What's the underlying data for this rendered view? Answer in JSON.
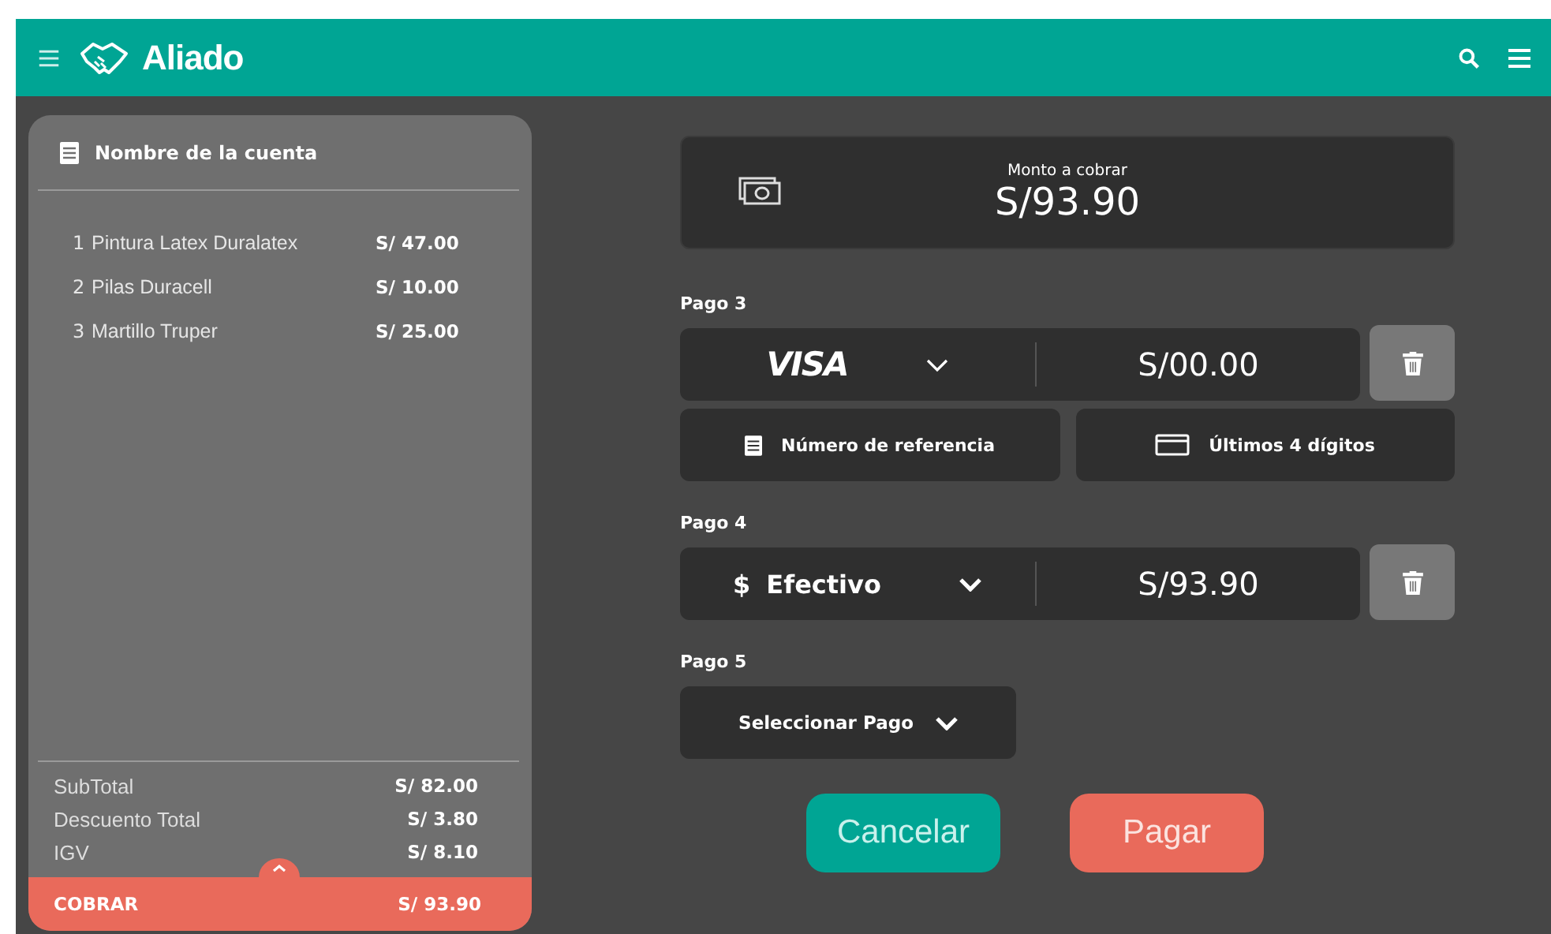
{
  "header": {
    "title": "Aliado"
  },
  "account": {
    "title": "Nombre de la cuenta",
    "items": [
      {
        "index": "1",
        "name": "Pintura Latex Duralatex",
        "price": "S/ 47.00"
      },
      {
        "index": "2",
        "name": "Pilas Duracell",
        "price": "S/ 10.00"
      },
      {
        "index": "3",
        "name": "Martillo Truper",
        "price": "S/ 25.00"
      }
    ],
    "totals": [
      {
        "label": "SubTotal",
        "value": "S/ 82.00"
      },
      {
        "label": "Descuento Total",
        "value": "S/ 3.80"
      },
      {
        "label": "IGV",
        "value": "S/ 8.10"
      }
    ],
    "charge": {
      "label": "COBRAR",
      "value": "S/ 93.90"
    }
  },
  "amount": {
    "label": "Monto a cobrar",
    "value": "S/93.90"
  },
  "payments": [
    {
      "kind": "card",
      "label": "Pago 3",
      "method": "VISA",
      "amount": "S/00.00",
      "reference": "Número de referencia",
      "last_digits": "Últimos 4 dígitos"
    },
    {
      "kind": "cash",
      "label": "Pago 4",
      "symbol": "$",
      "method": "Efectivo",
      "amount": "S/93.90"
    },
    {
      "kind": "select",
      "label": "Pago 5",
      "method": "Seleccionar Pago"
    }
  ],
  "buttons": {
    "cancel": "Cancelar",
    "pay": "Pagar"
  }
}
